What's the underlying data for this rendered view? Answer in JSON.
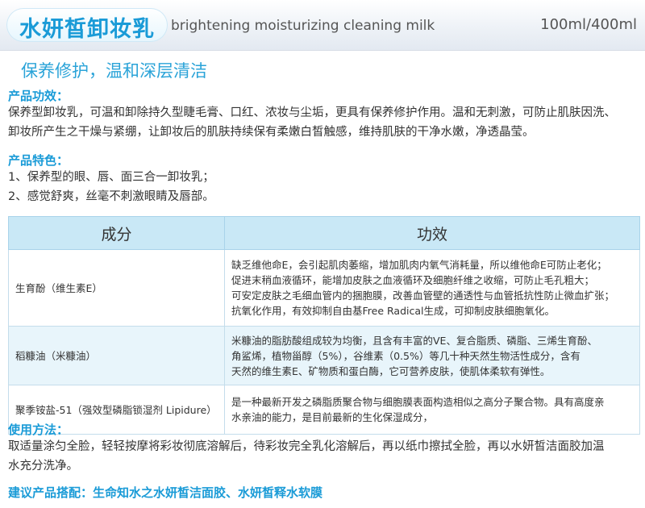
{
  "header": {
    "cn_title": "水妍皙卸妆乳",
    "en_title": "brightening moisturizing cleaning milk",
    "capacity": "100ml/400ml"
  },
  "slogan": "保养修护，温和深层清洁",
  "efficacy": {
    "title": "产品功效：",
    "lines": [
      "保养型卸妆乳，可温和卸除持久型睫毛膏、口红、浓妆与尘垢，更具有保养修护作用。温和无刺激，可防止肌肤因洗、",
      "卸妆所产生之干燥与紧绷，让卸妆后的肌肤持续保有柔嫩白皙触感，维持肌肤的干净水嫩，净透晶莹。"
    ]
  },
  "features": {
    "title": "产品特色：",
    "lines": [
      "1、保养型的眼、唇、面三合一卸妆乳；",
      "2、感觉舒爽，丝毫不刺激眼睛及唇部。"
    ]
  },
  "table": {
    "headers": [
      "成分",
      "功效"
    ],
    "rows": [
      {
        "ingredient": "生育酚（维生素E）",
        "effect": [
          "缺乏维他命E，会引起肌肉萎缩，增加肌肉内氧气消耗量，所以维他命E可防止老化；",
          "促进末稍血液循环，能增加皮肤之血液循环及细胞纤维之收缩，可防止毛孔粗大；",
          "可安定皮肤之毛细血管内的捆胞膜，改善血管壁的通透性与血管抵抗性防止微血扩张；",
          "抗氧化作用，有效抑制自由基Free  Radical生成，可抑制皮肤细胞氧化。"
        ]
      },
      {
        "ingredient": "稻糠油（米糠油）",
        "effect": [
          "米糠油的脂肪酸组成较为均衡，且含有丰富的VE、复合脂质、磷脂、三烯生育酚、",
          "角鲨烯，植物甾醇（5%），谷维素（0.5%）等几十种天然生物活性成分，含有",
          "天然的维生素E、矿物质和蛋白酶，它可营养皮肤，使肌体柔软有弹性。"
        ]
      },
      {
        "ingredient": "聚季铵盐-51（强效型磷脂锁湿剂 Lipidure）",
        "effect": [
          "是一种最新开发之磷脂质聚合物与细胞膜表面构造相似之高分子聚合物。具有高度亲",
          "水亲油的能力，是目前最新的生化保湿成分，"
        ]
      }
    ]
  },
  "usage": {
    "title": "使用方法：",
    "lines": [
      "取适量涂匀全脸，轻轻按摩将彩妆彻底溶解后，待彩妆完全乳化溶解后，再以纸巾擦拭全脸，再以水妍皙洁面胶加温",
      "水充分洗净。"
    ]
  },
  "recommend": {
    "text": "建议产品搭配：生命知水之水妍皙洁面胶、水妍皙释水软膜"
  }
}
